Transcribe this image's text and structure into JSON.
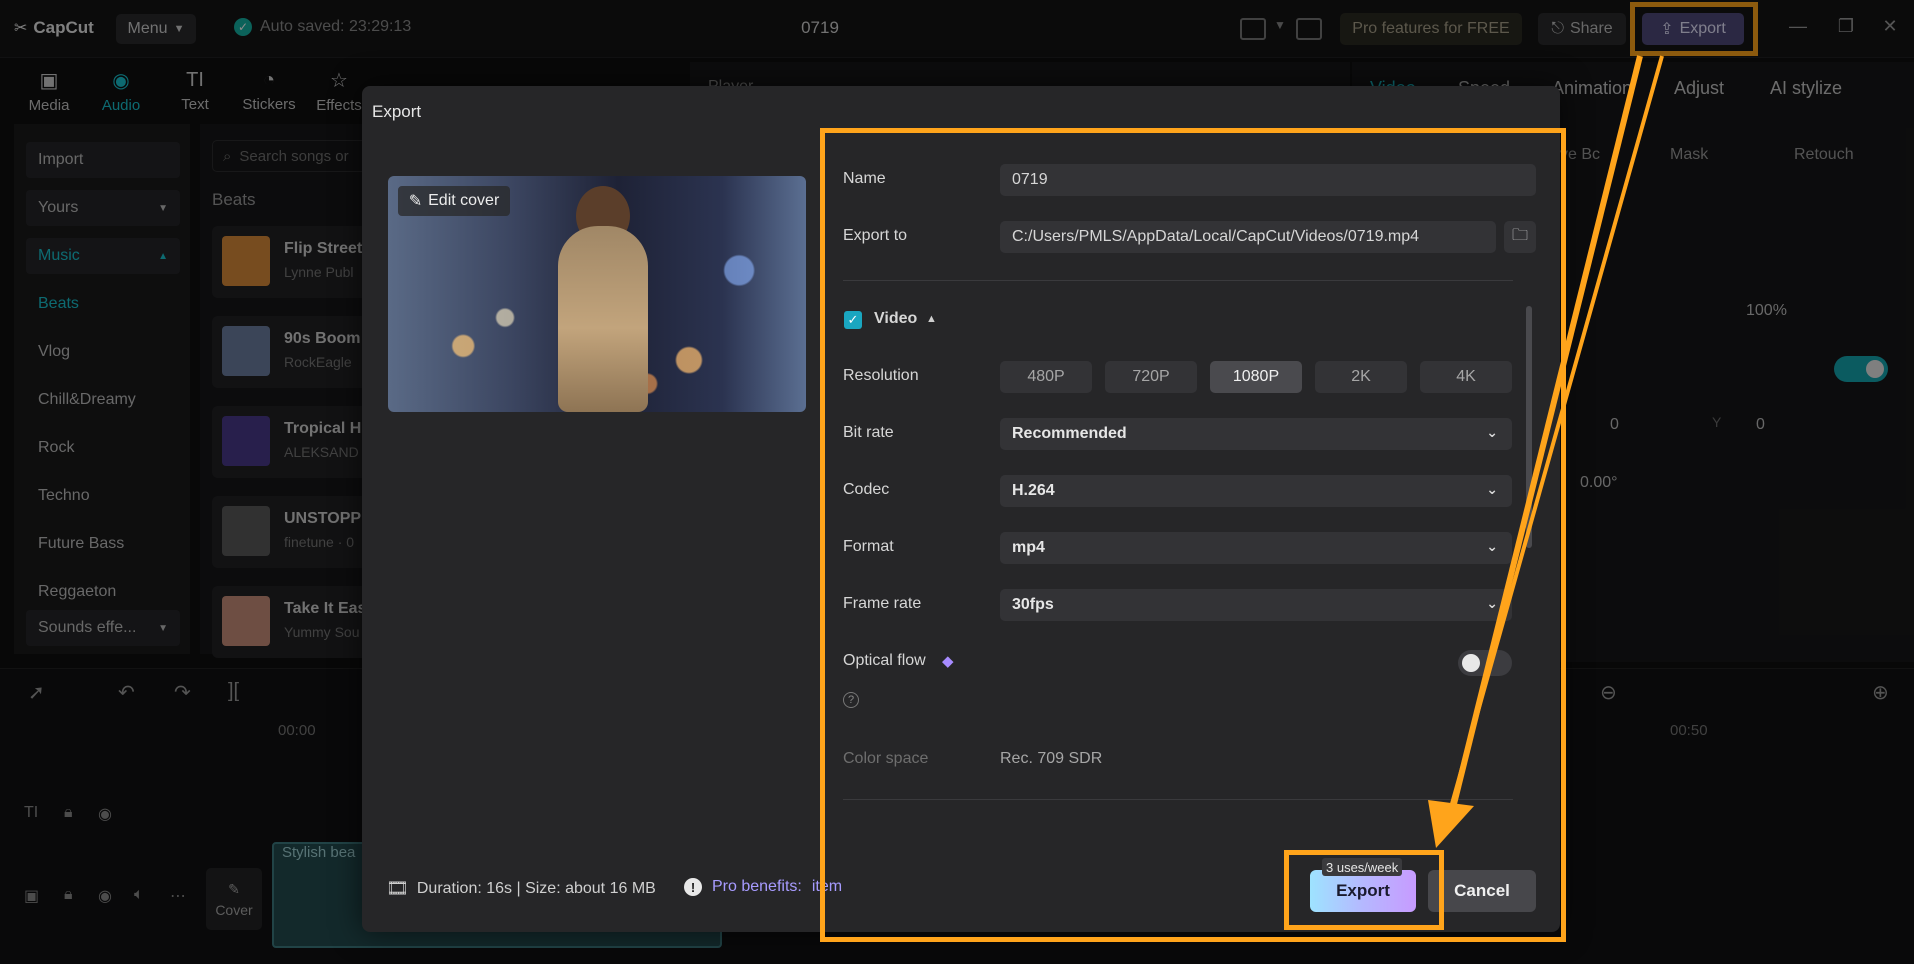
{
  "app": {
    "name": "CapCut",
    "menu_label": "Menu",
    "auto_saved": "Auto saved: 23:29:13",
    "project_title": "0719",
    "pro_features": "Pro features for FREE",
    "share_label": "Share",
    "export_label": "Export"
  },
  "tools": [
    {
      "label": "Media",
      "icon": "media-icon"
    },
    {
      "label": "Audio",
      "icon": "audio-icon"
    },
    {
      "label": "Text",
      "icon": "text-icon"
    },
    {
      "label": "Stickers",
      "icon": "stickers-icon"
    },
    {
      "label": "Effects",
      "icon": "effects-icon"
    }
  ],
  "sidebar": {
    "import": "Import",
    "yours": "Yours",
    "music": "Music",
    "items": [
      "Beats",
      "Vlog",
      "Chill&Dreamy",
      "Rock",
      "Techno",
      "Future Bass",
      "Reggaeton"
    ],
    "sounds": "Sounds effe..."
  },
  "music_panel": {
    "search_placeholder": "Search songs or",
    "section": "Beats",
    "tracks": [
      {
        "title": "Flip Street",
        "artist": "Lynne Publ"
      },
      {
        "title": "90s Boom",
        "artist": "RockEagle"
      },
      {
        "title": "Tropical H",
        "artist": "ALEKSAND"
      },
      {
        "title": "UNSTOPP",
        "artist": "finetune · 0"
      },
      {
        "title": "Take It Eas",
        "artist": "Yummy Sou"
      }
    ]
  },
  "player": {
    "label": "Player"
  },
  "right_panel": {
    "tabs": [
      "Video",
      "Speed",
      "Animation",
      "Adjust",
      "AI stylize"
    ],
    "subtabs": [
      "ve Bc",
      "Mask",
      "Retouch"
    ],
    "scale": "100%",
    "x_val": "0",
    "y_label": "Y",
    "y_val": "0",
    "rotation": "0.00°"
  },
  "timeline": {
    "time_start": "00:00",
    "time_end": "00:50",
    "clip_label": "Stylish bea",
    "cover_label": "Cover"
  },
  "modal": {
    "title": "Export",
    "edit_cover": "Edit cover",
    "name_label": "Name",
    "name_value": "0719",
    "export_to_label": "Export to",
    "export_path": "C:/Users/PMLS/AppData/Local/CapCut/Videos/0719.mp4",
    "video_section": "Video",
    "resolution_label": "Resolution",
    "resolutions": [
      "480P",
      "720P",
      "1080P",
      "2K",
      "4K"
    ],
    "selected_resolution": "1080P",
    "bitrate_label": "Bit rate",
    "bitrate_value": "Recommended",
    "codec_label": "Codec",
    "codec_value": "H.264",
    "format_label": "Format",
    "format_value": "mp4",
    "framerate_label": "Frame rate",
    "framerate_value": "30fps",
    "optical_flow_label": "Optical flow",
    "color_space_label": "Color space",
    "color_space_value": "Rec. 709 SDR",
    "duration_info": "Duration: 16s | Size: about 16 MB",
    "pro_benefits": "Pro benefits:",
    "pro_item": "item",
    "uses_badge": "3 uses/week",
    "export_button": "Export",
    "cancel_button": "Cancel"
  },
  "colors": {
    "accent_teal": "#19c2ce",
    "highlight_orange": "#ffa41b",
    "pro_purple": "#a79bff"
  }
}
